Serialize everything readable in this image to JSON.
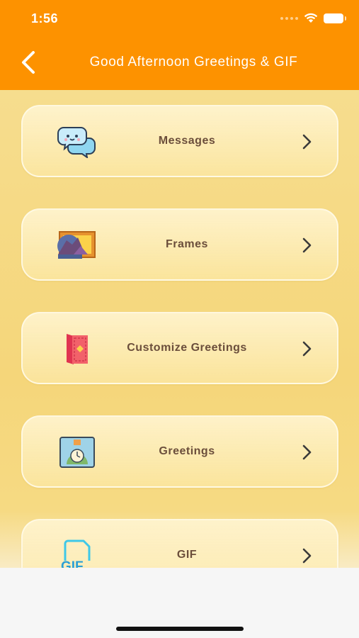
{
  "status_bar": {
    "time": "1:56"
  },
  "header": {
    "title": "Good Afternoon Greetings & GIF"
  },
  "menu": {
    "items": [
      {
        "label": "Messages",
        "icon": "chat-bubbles-icon"
      },
      {
        "label": "Frames",
        "icon": "landscape-frame-icon"
      },
      {
        "label": "Customize Greetings",
        "icon": "greeting-card-icon"
      },
      {
        "label": "Greetings",
        "icon": "clock-picture-icon"
      },
      {
        "label": "GIF",
        "icon": "gif-icon",
        "icon_text": "GIF"
      }
    ]
  },
  "colors": {
    "header": "#fd9200",
    "content_bg": "#f5d67a",
    "label_text": "#6b4e3b"
  }
}
